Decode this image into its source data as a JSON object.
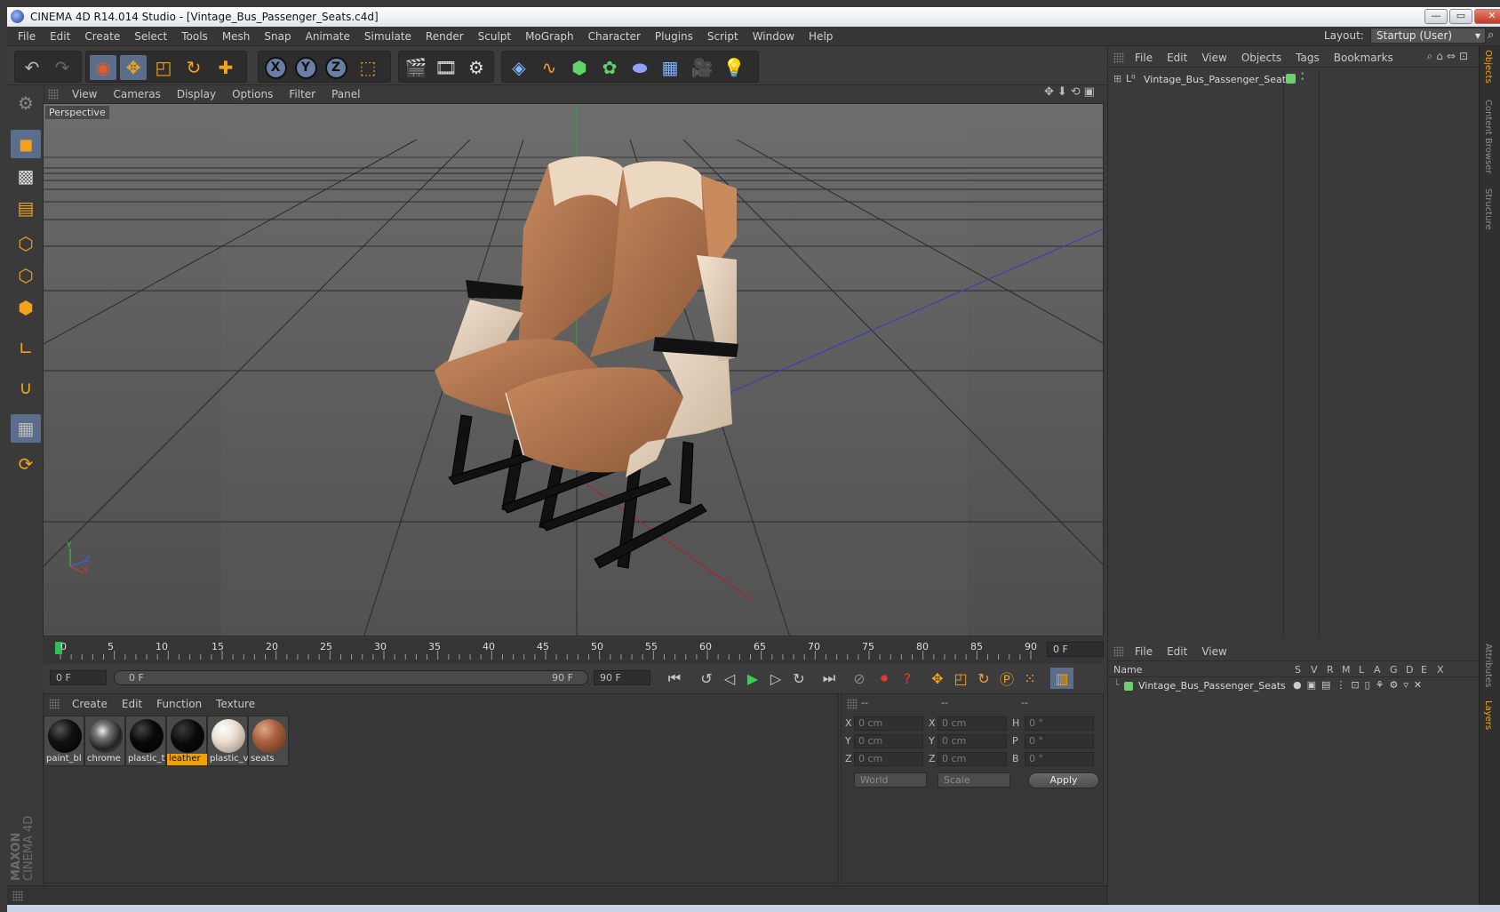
{
  "window": {
    "title": "CINEMA 4D R14.014 Studio - [Vintage_Bus_Passenger_Seats.c4d]",
    "min": "—",
    "max": "▭",
    "close": "✕"
  },
  "menu": [
    "File",
    "Edit",
    "Create",
    "Select",
    "Tools",
    "Mesh",
    "Snap",
    "Animate",
    "Simulate",
    "Render",
    "Sculpt",
    "MoGraph",
    "Character",
    "Plugins",
    "Script",
    "Window",
    "Help"
  ],
  "layout": {
    "label": "Layout:",
    "value": "Startup (User)"
  },
  "viewport": {
    "menu": [
      "View",
      "Cameras",
      "Display",
      "Options",
      "Filter",
      "Panel"
    ],
    "label": "Perspective",
    "axis_y": "Y",
    "axis_z": "Z",
    "axis_x": "X"
  },
  "timeline": {
    "ticks": [
      "0",
      "5",
      "10",
      "15",
      "20",
      "25",
      "30",
      "35",
      "40",
      "45",
      "50",
      "55",
      "60",
      "65",
      "70",
      "75",
      "80",
      "85",
      "90"
    ],
    "current_frame": "0 F",
    "start": "0 F",
    "range_start": "0 F",
    "range_end": "90 F",
    "end": "90 F"
  },
  "materials": {
    "menu": [
      "Create",
      "Edit",
      "Function",
      "Texture"
    ],
    "items": [
      {
        "label": "paint_bl"
      },
      {
        "label": "chrome"
      },
      {
        "label": "plastic_t"
      },
      {
        "label": "leather"
      },
      {
        "label": "plastic_v"
      },
      {
        "label": "seats"
      }
    ]
  },
  "coordinates": {
    "headers": [
      "--",
      "--",
      "--"
    ],
    "rows": [
      {
        "l1": "X",
        "v1": "0 cm",
        "l2": "X",
        "v2": "0 cm",
        "l3": "H",
        "v3": "0 °"
      },
      {
        "l1": "Y",
        "v1": "0 cm",
        "l2": "Y",
        "v2": "0 cm",
        "l3": "P",
        "v3": "0 °"
      },
      {
        "l1": "Z",
        "v1": "0 cm",
        "l2": "Z",
        "v2": "0 cm",
        "l3": "B",
        "v3": "0 °"
      }
    ],
    "mode": "World",
    "type": "Scale",
    "apply": "Apply"
  },
  "objects": {
    "menu": [
      "File",
      "Edit",
      "View",
      "Objects",
      "Tags",
      "Bookmarks"
    ],
    "item": "Vintage_Bus_Passenger_Seats"
  },
  "layers": {
    "menu": [
      "File",
      "Edit",
      "View"
    ],
    "name_header": "Name",
    "flags": [
      "S",
      "V",
      "R",
      "M",
      "L",
      "A",
      "G",
      "D",
      "E",
      "X"
    ],
    "item": "Vintage_Bus_Passenger_Seats"
  },
  "right_tabs": [
    "Objects",
    "Content Browser",
    "Structure",
    "Attributes",
    "Layers"
  ],
  "brand": {
    "line1": "MAXON",
    "line2": "CINEMA 4D"
  },
  "colors": {
    "accent": "#5a6d8a",
    "selected_material": "#f0a000",
    "layer_green": "#6fcf6f"
  }
}
